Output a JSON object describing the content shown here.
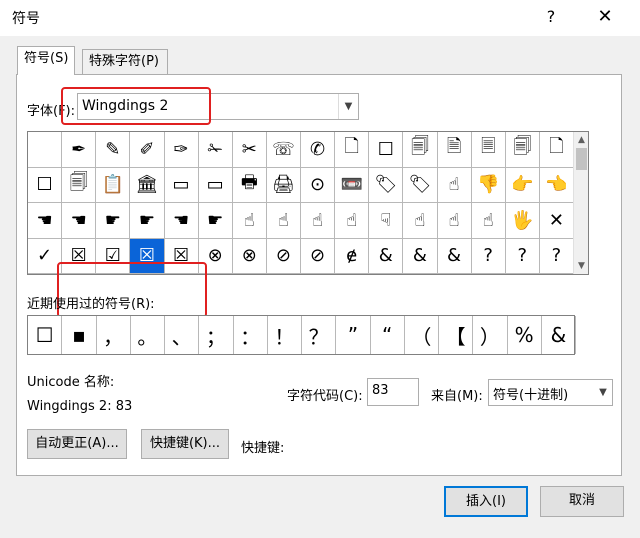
{
  "window": {
    "title": "符号",
    "help": "?",
    "close": "✕"
  },
  "tabs": [
    {
      "label": "符号(S)",
      "active": true
    },
    {
      "label": "特殊字符(P)",
      "active": false
    }
  ],
  "font": {
    "label": "字体(F):",
    "value": "Wingdings 2"
  },
  "grid": {
    "cells": [
      "",
      "✒",
      "✎",
      "✐",
      "✑",
      "✁",
      "✂",
      "☏",
      "✆",
      "🗋",
      "☐",
      "🗐",
      "🗎",
      "🗏",
      "🗐",
      "🗋",
      "☐",
      "🗐",
      "📋",
      "🏛",
      "▭",
      "▭",
      "🖶",
      "🖨",
      "⊙",
      "📼",
      "🏷",
      "🏷",
      "☝",
      "👎",
      "👉",
      "👈",
      "☚",
      "☚",
      "☛",
      "☛",
      "☚",
      "☛",
      "☝",
      "☝",
      "☝",
      "☝",
      "☟",
      "☝",
      "☝",
      "☝",
      "🖐",
      "✕",
      "✓",
      "☒",
      "☑",
      "☒",
      "☒",
      "⊗",
      "⊗",
      "⊘",
      "⊘",
      "ɇ",
      "&",
      "&",
      "&",
      "?",
      "?",
      "?"
    ],
    "selected_index": 51
  },
  "recent": {
    "label": "近期使用过的符号(R):",
    "items": [
      "☐",
      "▪",
      "，",
      "。",
      "、",
      "；",
      "：",
      "！",
      "？",
      "”",
      "“",
      "（",
      "【",
      "）",
      "%",
      "&"
    ]
  },
  "unicode": {
    "label": "Unicode 名称:",
    "name": "Wingdings 2: 83"
  },
  "charcode": {
    "label": "字符代码(C):",
    "value": "83"
  },
  "from": {
    "label": "来自(M):",
    "value": "符号(十进制)"
  },
  "buttons": {
    "autocorrect": "自动更正(A)...",
    "shortcut_key": "快捷键(K)...",
    "shortcut_label": "快捷键:",
    "insert": "插入(I)",
    "cancel": "取消"
  },
  "colors": {
    "selection": "#0a64d8",
    "highlight": "#e02020",
    "focus": "#0078d7"
  }
}
